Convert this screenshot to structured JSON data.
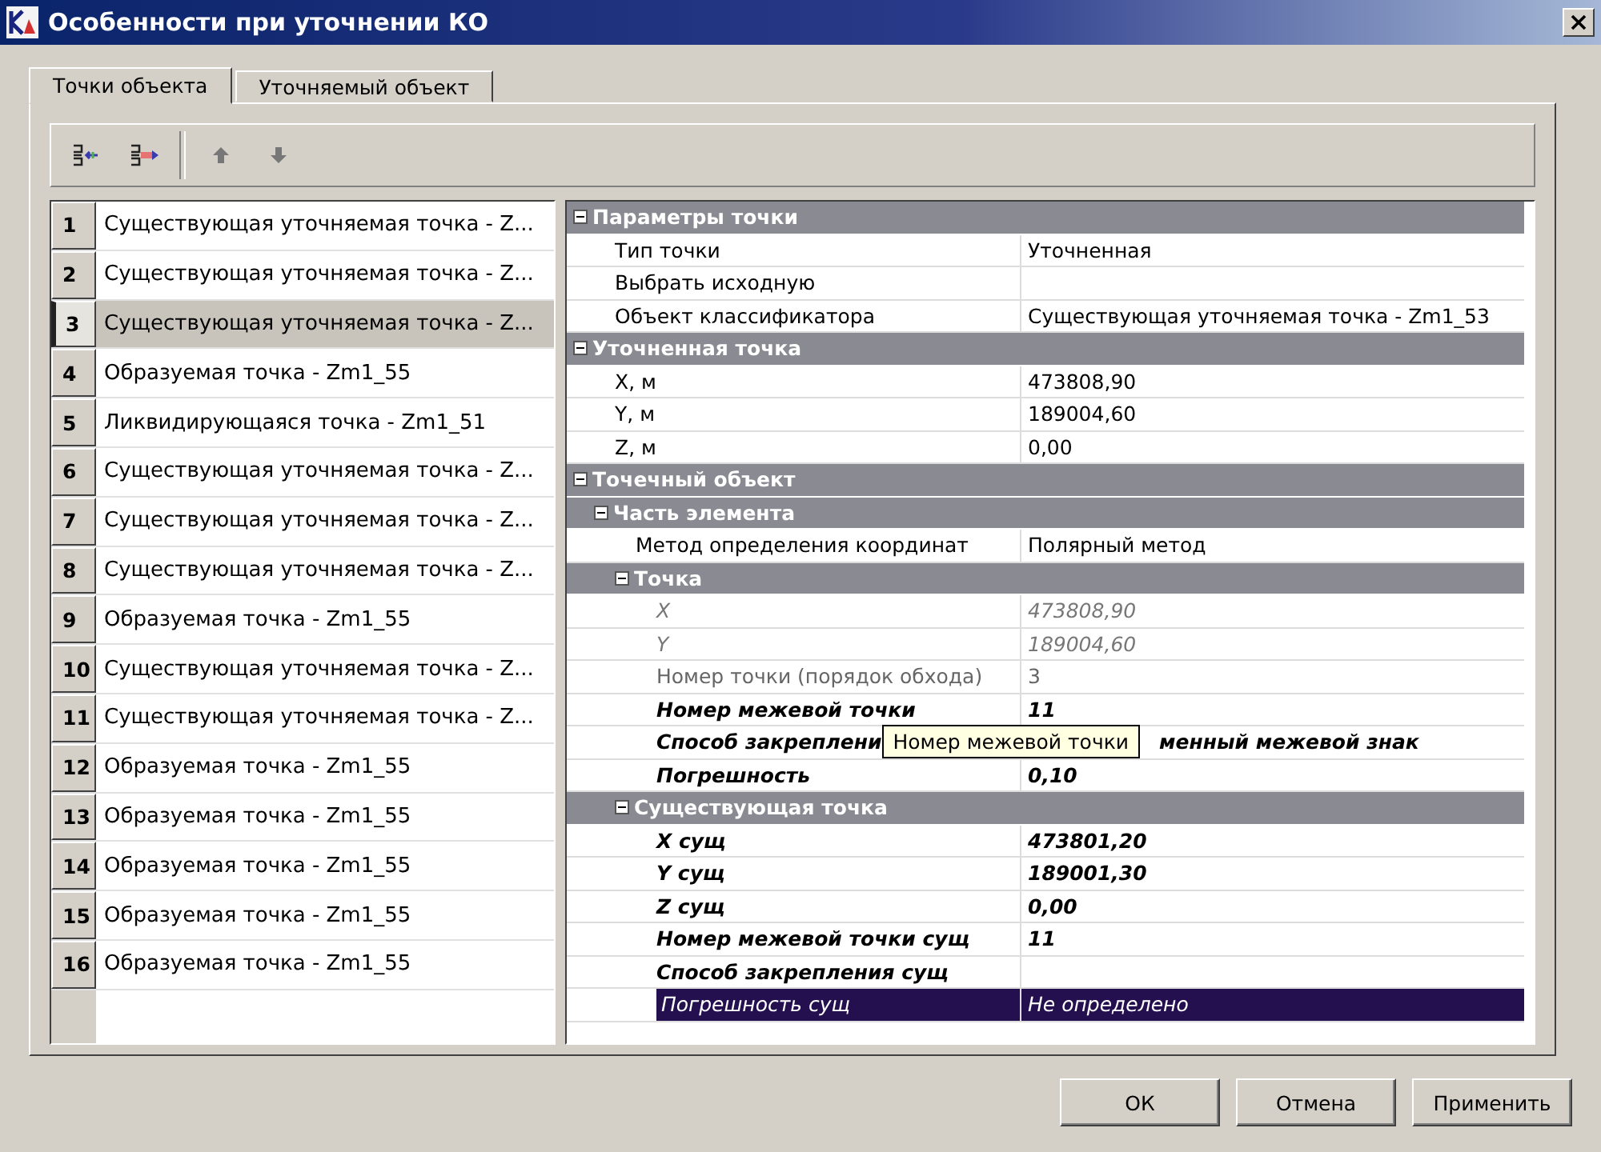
{
  "window": {
    "title": "Особенности при уточнении КО"
  },
  "tabs": [
    {
      "label": "Точки объекта",
      "selected": true
    },
    {
      "label": "Уточняемый объект",
      "selected": false
    }
  ],
  "toolbar": [
    {
      "kind": "insert"
    },
    {
      "kind": "append"
    },
    {
      "kind": "separator"
    },
    {
      "kind": "up"
    },
    {
      "kind": "down"
    }
  ],
  "points": [
    {
      "number": "1",
      "label": "Существующая уточняемая точка - Z...",
      "selected": false
    },
    {
      "number": "2",
      "label": "Существующая уточняемая точка - Z...",
      "selected": false
    },
    {
      "number": "3",
      "label": "Существующая уточняемая точка - Z...",
      "selected": true
    },
    {
      "number": "4",
      "label": "Образуемая точка - Zm1_55",
      "selected": false
    },
    {
      "number": "5",
      "label": "Ликвидирующаяся точка - Zm1_51",
      "selected": false
    },
    {
      "number": "6",
      "label": "Существующая уточняемая точка - Z...",
      "selected": false
    },
    {
      "number": "7",
      "label": "Существующая уточняемая точка - Z...",
      "selected": false
    },
    {
      "number": "8",
      "label": "Существующая уточняемая точка - Z...",
      "selected": false
    },
    {
      "number": "9",
      "label": "Образуемая точка - Zm1_55",
      "selected": false
    },
    {
      "number": "10",
      "label": "Существующая уточняемая точка - Z...",
      "selected": false
    },
    {
      "number": "11",
      "label": "Существующая уточняемая точка - Z...",
      "selected": false
    },
    {
      "number": "12",
      "label": "Образуемая точка - Zm1_55",
      "selected": false
    },
    {
      "number": "13",
      "label": "Образуемая точка - Zm1_55",
      "selected": false
    },
    {
      "number": "14",
      "label": "Образуемая точка - Zm1_55",
      "selected": false
    },
    {
      "number": "15",
      "label": "Образуемая точка - Zm1_55",
      "selected": false
    },
    {
      "number": "16",
      "label": "Образуемая точка - Zm1_55",
      "selected": false
    }
  ],
  "properties": [
    {
      "title": "Параметры точки",
      "expanded": true,
      "rows": [
        {
          "label": "Тип точки",
          "value": "Уточненная",
          "kind": "normal",
          "selected": false
        },
        {
          "label": "Выбрать исходную",
          "kind": "normal",
          "selected": false
        },
        {
          "label": "Объект классификатора",
          "value": "Существующая уточняемая точка - Zm1_53",
          "kind": "normal",
          "selected": false
        }
      ]
    },
    {
      "title": "Уточненная точка",
      "expanded": true,
      "rows": [
        {
          "label": "X, м",
          "value": "473808,90",
          "kind": "normal",
          "selected": false
        },
        {
          "label": "Y, м",
          "value": "189004,60",
          "kind": "normal",
          "selected": false
        },
        {
          "label": "Z, м",
          "value": "0,00",
          "kind": "normal",
          "selected": false
        }
      ]
    },
    {
      "title": "Точечный объект",
      "expanded": true,
      "children": [
        {
          "title": "Часть элемента",
          "expanded": true,
          "rows": [
            {
              "label": "Метод определения  координат",
              "value": "Полярный метод",
              "kind": "normal",
              "selected": false
            }
          ],
          "children": [
            {
              "title": "Точка",
              "expanded": true,
              "rows": [
                {
                  "label": "X",
                  "value": "473808,90",
                  "kind": "computed",
                  "selected": false
                },
                {
                  "label": "Y",
                  "value": "189004,60",
                  "kind": "computed",
                  "selected": false
                },
                {
                  "label": "Номер точки (порядок обхода)",
                  "value": "3",
                  "kind": "readonly",
                  "selected": false
                },
                {
                  "label": "Номер межевой точки",
                  "value": "11",
                  "kind": "editable",
                  "selected": false
                },
                {
                  "label": "Способ закреплени",
                  "value": "менный межевой знак",
                  "kind": "editable",
                  "selected": false,
                  "tooltip": "Номер межевой точки"
                },
                {
                  "label": "Погрешность",
                  "value": "0,10",
                  "kind": "editable",
                  "selected": false
                }
              ]
            },
            {
              "title": "Существующая точка",
              "expanded": true,
              "rows": [
                {
                  "label": "X сущ",
                  "value": "473801,20",
                  "kind": "editable",
                  "selected": false
                },
                {
                  "label": "Y сущ",
                  "value": "189001,30",
                  "kind": "editable",
                  "selected": false
                },
                {
                  "label": "Z сущ",
                  "value": "0,00",
                  "kind": "editable",
                  "selected": false
                },
                {
                  "label": "Номер межевой точки сущ",
                  "value": "11",
                  "kind": "editable",
                  "selected": false
                },
                {
                  "label": "Способ закрепления сущ",
                  "kind": "editable",
                  "selected": false
                },
                {
                  "label": "Погрешность сущ",
                  "value": "Не определено",
                  "kind": "editable",
                  "selected": true
                }
              ]
            }
          ]
        }
      ]
    }
  ],
  "buttons": [
    {
      "label": "ОК"
    },
    {
      "label": "Отмена"
    },
    {
      "label": "Применить"
    }
  ]
}
